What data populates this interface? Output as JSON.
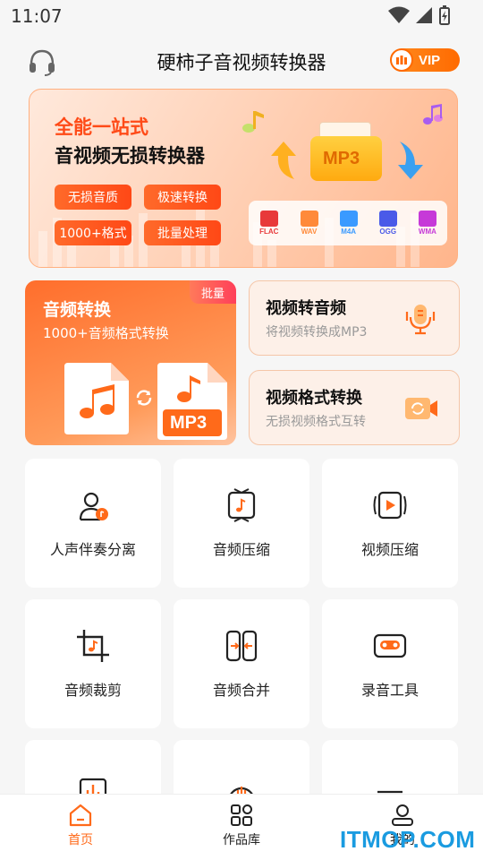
{
  "status": {
    "time": "11:07"
  },
  "app": {
    "title": "硬柿子音视频转换器",
    "vip": "VIP"
  },
  "banner": {
    "line1": "全能一站式",
    "line2": "音视频无损转换器",
    "tags": [
      "无损音质",
      "极速转换",
      "1000+格式",
      "批量处理"
    ],
    "mp3": "MP3",
    "formats": [
      {
        "label": "FLAC",
        "color": "#e8393a"
      },
      {
        "label": "WAV",
        "color": "#ff8a3a"
      },
      {
        "label": "M4A",
        "color": "#3a9aff"
      },
      {
        "label": "OGG",
        "color": "#4a5ae8"
      },
      {
        "label": "WMA",
        "color": "#c63ad8"
      }
    ]
  },
  "cards": {
    "audio": {
      "title": "音频转换",
      "subtitle": "1000+音频格式转换",
      "badge": "批量",
      "mp3": "MP3"
    },
    "video_to_audio": {
      "title": "视频转音频",
      "subtitle": "将视频转换成MP3"
    },
    "video_format": {
      "title": "视频格式转换",
      "subtitle": "无损视频格式互转"
    }
  },
  "tools": [
    {
      "label": "人声伴奏分离",
      "icon": "vocal-separation-icon"
    },
    {
      "label": "音频压缩",
      "icon": "audio-compress-icon"
    },
    {
      "label": "视频压缩",
      "icon": "video-compress-icon"
    },
    {
      "label": "音频裁剪",
      "icon": "audio-crop-icon"
    },
    {
      "label": "音频合并",
      "icon": "audio-merge-icon"
    },
    {
      "label": "录音工具",
      "icon": "recorder-icon"
    }
  ],
  "nav": [
    {
      "label": "首页",
      "icon": "home-icon",
      "active": true
    },
    {
      "label": "作品库",
      "icon": "grid-icon",
      "active": false
    },
    {
      "label": "我的",
      "icon": "profile-icon",
      "active": false
    }
  ],
  "watermark": "ITMOP.COM",
  "colors": {
    "accent": "#ff6a1a",
    "accent_red": "#ff4a17"
  }
}
